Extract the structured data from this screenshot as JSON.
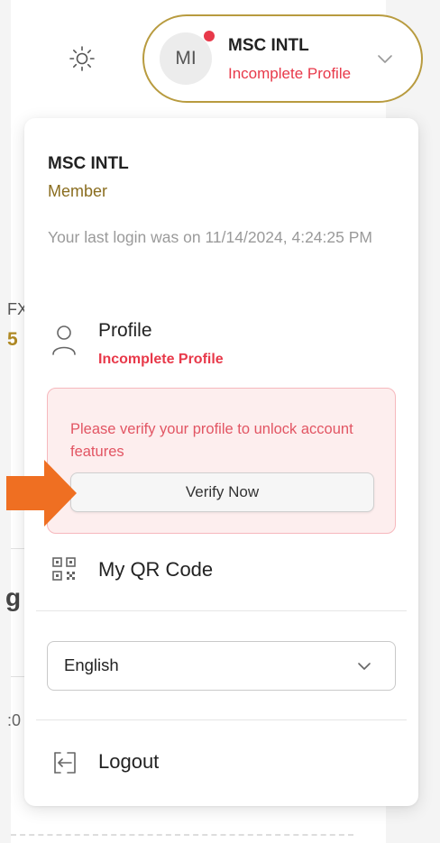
{
  "background": {
    "fragments": [
      "FX",
      "5",
      "g",
      ":0"
    ]
  },
  "header": {
    "theme_icon": "sun-icon",
    "user": {
      "initials": "MI",
      "name": "MSC INTL",
      "status": "Incomplete Profile",
      "notification_dot_color": "#e8394a",
      "chevron_icon": "chevron-down-icon"
    }
  },
  "menu": {
    "name": "MSC INTL",
    "role": "Member",
    "last_login": "Your last login was on 11/14/2024, 4:24:25 PM",
    "profile": {
      "icon": "user-icon",
      "label": "Profile",
      "status": "Incomplete Profile"
    },
    "verify": {
      "message": "Please verify your profile to unlock account features",
      "button_label": "Verify Now"
    },
    "qr": {
      "icon": "qr-code-icon",
      "label": "My QR Code"
    },
    "language": {
      "selected": "English",
      "chevron_icon": "chevron-down-icon"
    },
    "logout": {
      "icon": "logout-icon",
      "label": "Logout"
    }
  },
  "colors": {
    "accent_gold": "#b89b3f",
    "role_gold": "#8a6d1f",
    "alert_red": "#e8394a",
    "verify_bg": "#fdeeee",
    "callout_orange": "#ef6f22"
  }
}
